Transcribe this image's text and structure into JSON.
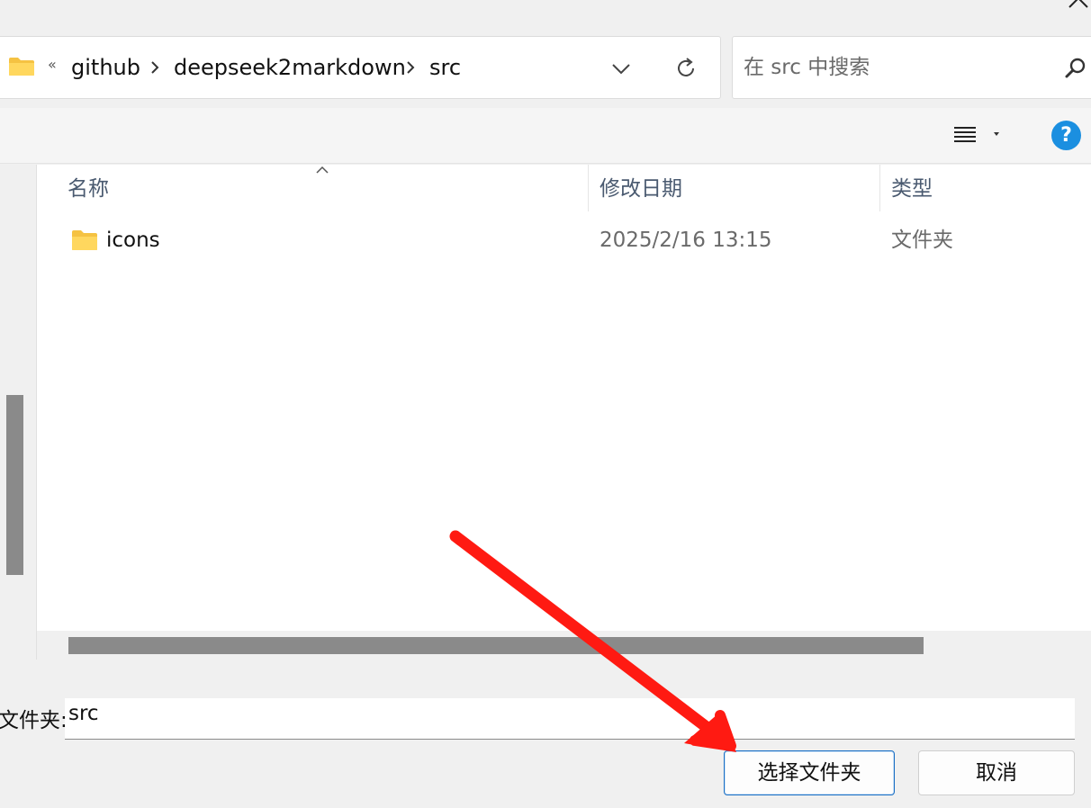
{
  "address_bar": {
    "overflow": "«",
    "breadcrumbs": [
      "github",
      "deepseek2markdown",
      "src"
    ]
  },
  "search": {
    "placeholder": "在 src 中搜索"
  },
  "file_list": {
    "columns": [
      "名称",
      "修改日期",
      "类型"
    ],
    "rows": [
      {
        "name": "icons",
        "modified": "2025/2/16 13:15",
        "type": "文件夹"
      }
    ]
  },
  "toolbar": {
    "help": "?"
  },
  "footer": {
    "folder_label": "文件夹:",
    "folder_value": "src",
    "select_button": "选择文件夹",
    "cancel_button": "取消"
  },
  "colors": {
    "accent": "#1b8fe0",
    "annotation_arrow": "#ff1a12"
  }
}
